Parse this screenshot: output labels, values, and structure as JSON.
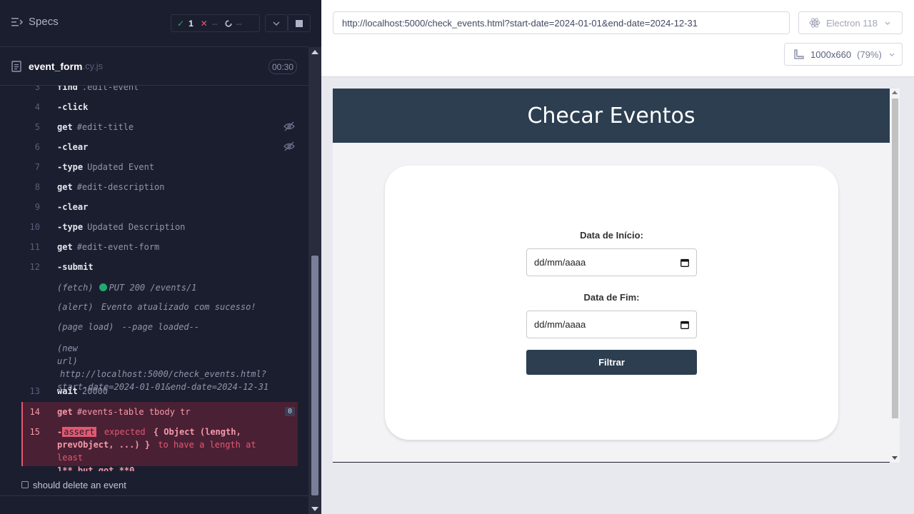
{
  "reporter": {
    "specs_label": "Specs",
    "stats": {
      "passed": "1",
      "failed": "--",
      "pending": "--"
    },
    "spec_name": "event_form",
    "spec_ext": ".cy.js",
    "duration": "00:30",
    "commands": [
      {
        "num": "3",
        "kw": "find",
        "arg": ".edit-event"
      },
      {
        "num": "4",
        "kw": "-click",
        "arg": ""
      },
      {
        "num": "5",
        "kw": "get",
        "arg": "#edit-title"
      },
      {
        "num": "6",
        "kw": "-clear",
        "arg": ""
      },
      {
        "num": "7",
        "kw": "-type",
        "arg": "Updated Event"
      },
      {
        "num": "8",
        "kw": "get",
        "arg": "#edit-description"
      },
      {
        "num": "9",
        "kw": "-clear",
        "arg": ""
      },
      {
        "num": "10",
        "kw": "-type",
        "arg": "Updated Description"
      },
      {
        "num": "11",
        "kw": "get",
        "arg": "#edit-event-form"
      },
      {
        "num": "12",
        "kw": "-submit",
        "arg": ""
      }
    ],
    "events": {
      "fetch_label": "(fetch)",
      "fetch_value": "PUT 200 /events/1",
      "alert_label": "(alert)",
      "alert_value": "Evento atualizado com sucesso!",
      "pageload_label": "(page load)",
      "pageload_value": "--page loaded--",
      "newurl_label_1": "(new",
      "newurl_label_2": "url)",
      "newurl_value_1": "http://localhost:5000/check_events.html?",
      "newurl_value_2": "start-date=2024-01-01&end-date=2024-12-31"
    },
    "wait": {
      "num": "13",
      "kw": "wait",
      "arg": "20000"
    },
    "failed_get": {
      "num": "14",
      "kw": "get",
      "arg": "#events-table tbody tr",
      "count": "0"
    },
    "failed_assert": {
      "num": "15",
      "dash": "-",
      "tag": "assert",
      "word": "expected",
      "line1_obj": "{ Object (length,",
      "line2_obj": "prevObject, ...) }",
      "line2_rest": "to have a length at least",
      "line3": "1** but got **0"
    },
    "next_test": "should delete an event"
  },
  "aut": {
    "url": "http://localhost:5000/check_events.html?start-date=2024-01-01&end-date=2024-12-31",
    "browser": "Electron 118",
    "viewport": "1000x660",
    "viewport_pct": "(79%)",
    "app": {
      "title": "Checar Eventos",
      "start_label": "Data de Início:",
      "start_placeholder": "dd/mm/aaaa",
      "end_label": "Data de Fim:",
      "end_placeholder": "dd/mm/aaaa",
      "filter_button": "Filtrar"
    }
  },
  "colors": {
    "reporter_bg": "#1b1e2e",
    "pass": "#1fa971",
    "fail": "#e45770",
    "app_header": "#2c3e50"
  }
}
